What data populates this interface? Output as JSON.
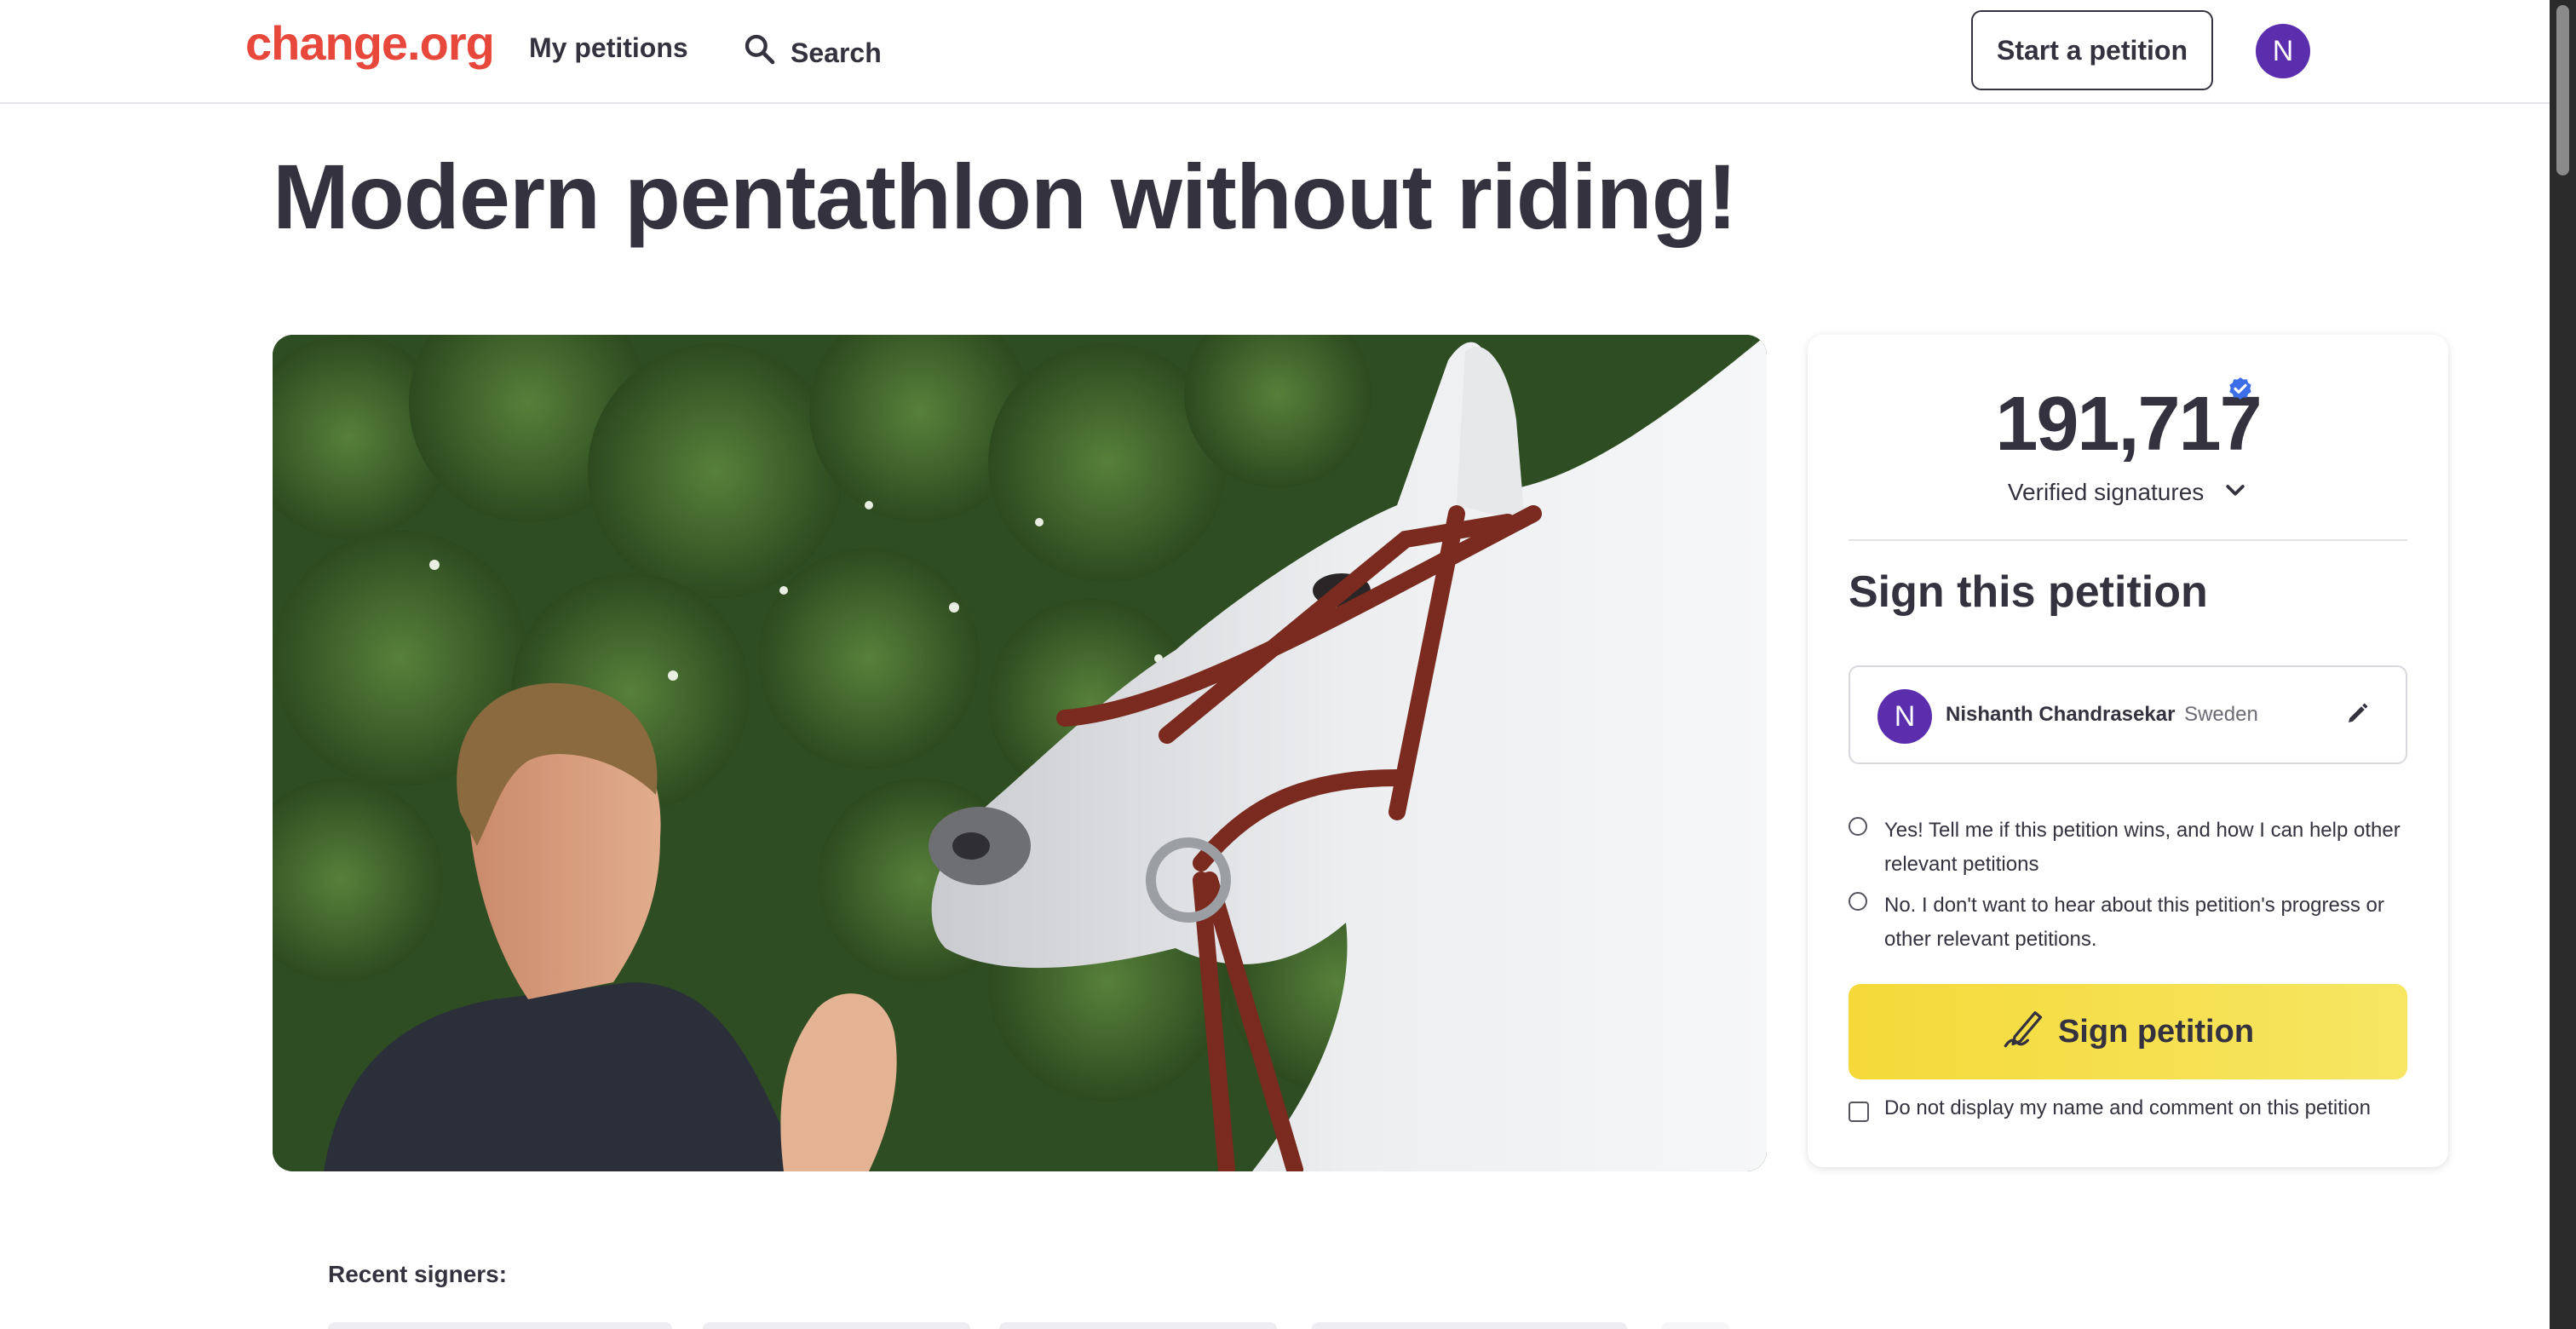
{
  "header": {
    "logo": "change.org",
    "my_petitions": "My petitions",
    "search": "Search",
    "start_petition": "Start a petition",
    "avatar_initial": "N"
  },
  "petition": {
    "title": "Modern pentathlon without riding!"
  },
  "photo": {
    "alt": "Woman smiling at a white horse wearing a brown bridle in front of green foliage"
  },
  "signatures": {
    "count": "191,717",
    "label": "Verified signatures"
  },
  "sign_panel": {
    "heading": "Sign this petition",
    "user_initial": "N",
    "user_name": "Nishanth Chandrasekar",
    "user_country": "Sweden",
    "option_yes": "Yes! Tell me if this petition wins, and how I can help other relevant petitions",
    "option_no": "No. I don't want to hear about this petition's progress or other relevant petitions.",
    "sign_button": "Sign petition",
    "hide_name_label": "Do not display my name and comment on this petition"
  },
  "recent": {
    "label": "Recent signers:"
  },
  "colors": {
    "brand": "#e8473c",
    "avatar": "#5b2eae",
    "sign_button": "#f5d939",
    "verified": "#3b6ee8",
    "text": "#34323f"
  }
}
